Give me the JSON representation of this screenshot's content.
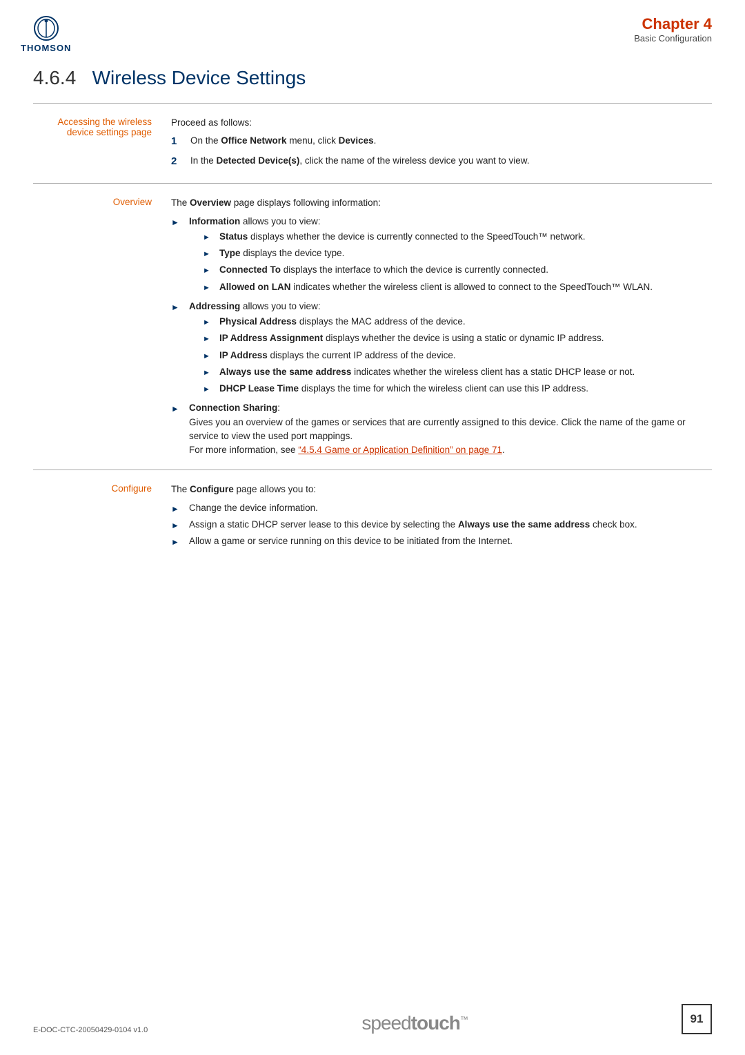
{
  "header": {
    "chapter_label": "Chapter 4",
    "chapter_subtitle": "Basic Configuration",
    "logo_text": "THOMSON"
  },
  "page_title": {
    "number": "4.6.4",
    "title": "Wireless Device Settings"
  },
  "sections": [
    {
      "id": "accessing",
      "label": "Accessing the wireless\ndevice settings page",
      "intro": "Proceed as follows:",
      "numbered_items": [
        {
          "num": "1",
          "html": "On the <b>Office Network</b> menu, click <b>Devices</b>."
        },
        {
          "num": "2",
          "html": "In the <b>Detected Device(s)</b>, click the name of the wireless device you want to view."
        }
      ]
    },
    {
      "id": "overview",
      "label": "Overview",
      "intro": "The <b>Overview</b> page displays following information:",
      "bullets": [
        {
          "text": "<b>Information</b> allows you to view:",
          "sub_bullets": [
            "<b>Status</b> displays whether the device is currently connected to the SpeedTouch™ network.",
            "<b>Type</b> displays the device type.",
            "<b>Connected To</b> displays the interface to which the device is currently connected.",
            "<b>Allowed on LAN</b> indicates whether the wireless client is allowed to connect to the SpeedTouch™ WLAN."
          ]
        },
        {
          "text": "<b>Addressing</b> allows you to view:",
          "sub_bullets": [
            "<b>Physical Address</b> displays the MAC address of the device.",
            "<b>IP Address Assignment</b> displays whether the device is using a static or dynamic IP address.",
            "<b>IP Address</b> displays the current IP address of the device.",
            "<b>Always use the same address</b> indicates whether the wireless client has a static DHCP lease or not.",
            "<b>DHCP Lease Time</b> displays the time for which the wireless client can use this IP address."
          ]
        },
        {
          "text": "<b>Connection Sharing</b>:",
          "extra": "Gives you an overview of the games or services that are currently assigned to this device. Click the name of the game or service to view the used port mappings.",
          "link_text": "For more information, see “4.5.4 Game or Application Definition” on page 71.",
          "sub_bullets": []
        }
      ]
    },
    {
      "id": "configure",
      "label": "Configure",
      "intro": "The <b>Configure</b> page allows you to:",
      "bullets_simple": [
        "Change the device information.",
        "Assign a static DHCP server lease to this device by selecting the <b>Always use the same address</b> check box.",
        "Allow a game or service running on this device to be initiated from the Internet."
      ]
    }
  ],
  "footer": {
    "doc_id": "E-DOC-CTC-20050429-0104 v1.0",
    "brand_speed": "speed",
    "brand_touch": "touch",
    "brand_tm": "™",
    "page_num": "91"
  }
}
